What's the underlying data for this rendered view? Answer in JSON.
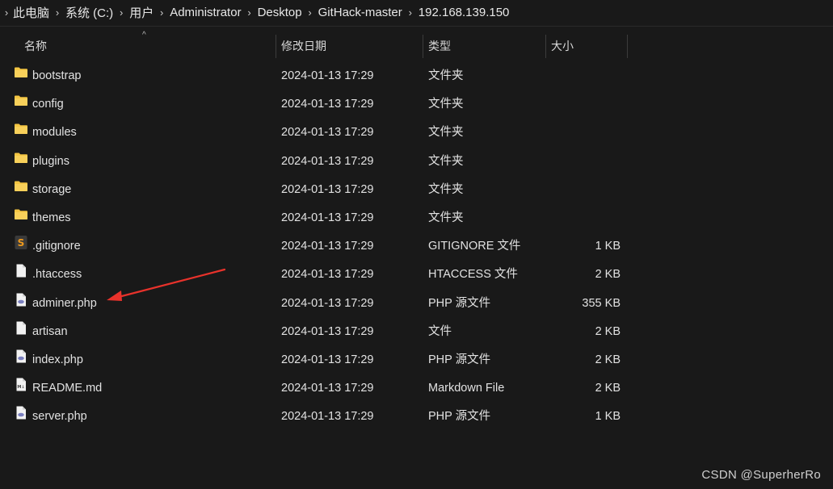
{
  "breadcrumb": {
    "items": [
      "此电脑",
      "系统 (C:)",
      "用户",
      "Administrator",
      "Desktop",
      "GitHack-master",
      "192.168.139.150"
    ],
    "separator": "›"
  },
  "columns": {
    "name": "名称",
    "modified": "修改日期",
    "type": "类型",
    "size": "大小"
  },
  "sort_indicator": "^",
  "files": [
    {
      "name": "bootstrap",
      "date": "2024-01-13 17:29",
      "type": "文件夹",
      "size": "",
      "icon": "folder-icon"
    },
    {
      "name": "config",
      "date": "2024-01-13 17:29",
      "type": "文件夹",
      "size": "",
      "icon": "folder-icon"
    },
    {
      "name": "modules",
      "date": "2024-01-13 17:29",
      "type": "文件夹",
      "size": "",
      "icon": "folder-icon"
    },
    {
      "name": "plugins",
      "date": "2024-01-13 17:29",
      "type": "文件夹",
      "size": "",
      "icon": "folder-icon"
    },
    {
      "name": "storage",
      "date": "2024-01-13 17:29",
      "type": "文件夹",
      "size": "",
      "icon": "folder-icon"
    },
    {
      "name": "themes",
      "date": "2024-01-13 17:29",
      "type": "文件夹",
      "size": "",
      "icon": "folder-icon"
    },
    {
      "name": ".gitignore",
      "date": "2024-01-13 17:29",
      "type": "GITIGNORE 文件",
      "size": "1 KB",
      "icon": "sublime-file-icon"
    },
    {
      "name": ".htaccess",
      "date": "2024-01-13 17:29",
      "type": "HTACCESS 文件",
      "size": "2 KB",
      "icon": "blank-file-icon"
    },
    {
      "name": "adminer.php",
      "date": "2024-01-13 17:29",
      "type": "PHP 源文件",
      "size": "355 KB",
      "icon": "php-file-icon"
    },
    {
      "name": "artisan",
      "date": "2024-01-13 17:29",
      "type": "文件",
      "size": "2 KB",
      "icon": "blank-file-icon"
    },
    {
      "name": "index.php",
      "date": "2024-01-13 17:29",
      "type": "PHP 源文件",
      "size": "2 KB",
      "icon": "php-file-icon"
    },
    {
      "name": "README.md",
      "date": "2024-01-13 17:29",
      "type": "Markdown File",
      "size": "2 KB",
      "icon": "markdown-file-icon"
    },
    {
      "name": "server.php",
      "date": "2024-01-13 17:29",
      "type": "PHP 源文件",
      "size": "1 KB",
      "icon": "php-file-icon"
    }
  ],
  "watermark": "CSDN @SuperherRo",
  "colors": {
    "background": "#191919",
    "text": "#e6e6e6",
    "folder": "#f4c542",
    "arrow": "#e8322b"
  }
}
